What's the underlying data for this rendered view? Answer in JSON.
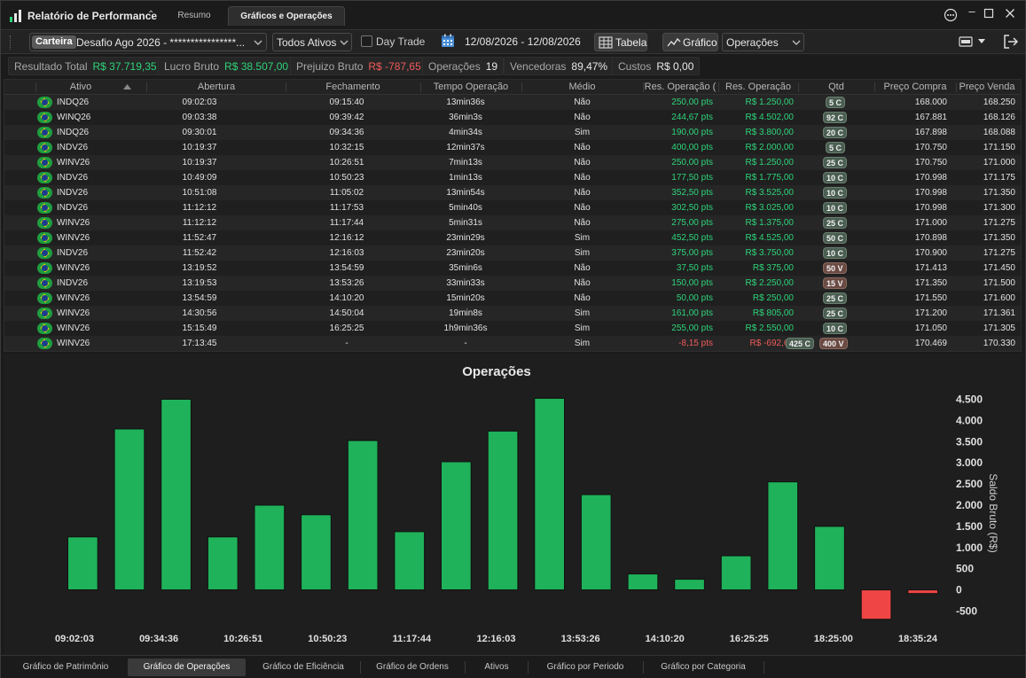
{
  "app": {
    "title": "Relatório de Performance",
    "tabs": [
      {
        "label": "Resumo"
      },
      {
        "label": "Gráficos e Operações"
      }
    ]
  },
  "toolbar": {
    "carteira_label": "Carteira",
    "carteira_name": "Desafio Ago 2026 - ****************...",
    "ativos_select": "Todos Ativos",
    "day_trade_label": "Day Trade",
    "date_range": "12/08/2026 - 12/08/2026",
    "tabela_label": "Tabela",
    "grafico_label": "Gráfico",
    "view_select": "Operações"
  },
  "summary": [
    {
      "key": "Resultado Total",
      "value": "R$ 37.719,35",
      "tone": "pos"
    },
    {
      "key": "Lucro Bruto",
      "value": "R$ 38.507,00",
      "tone": "pos"
    },
    {
      "key": "Prejuizo Bruto",
      "value": "R$ -787,65",
      "tone": "neg"
    },
    {
      "key": "Operações",
      "value": "19",
      "tone": ""
    },
    {
      "key": "Vencedoras",
      "value": "89,47%",
      "tone": ""
    },
    {
      "key": "Custos",
      "value": "R$ 0,00",
      "tone": ""
    }
  ],
  "table": {
    "headers": [
      "Ativo",
      "Abertura",
      "Fechamento",
      "Tempo Operação",
      "Médio",
      "Res. Operação (",
      "Res. Operação",
      "Qtd",
      "Preço Compra",
      "Preço Venda"
    ],
    "rows": [
      {
        "ativo": "INDQ26",
        "abertura": "09:02:03",
        "fechamento": "09:15:40",
        "tempo": "13min36s",
        "medio": "Não",
        "pts": "250,00 pts",
        "rs": "R$ 1.250,00",
        "tone": "pos",
        "qtd": [
          {
            "t": "5 C",
            "k": "c"
          }
        ],
        "compra": "168.000",
        "venda": "168.250"
      },
      {
        "ativo": "WINQ26",
        "abertura": "09:03:38",
        "fechamento": "09:39:42",
        "tempo": "36min3s",
        "medio": "Não",
        "pts": "244,67 pts",
        "rs": "R$ 4.502,00",
        "tone": "pos",
        "qtd": [
          {
            "t": "92 C",
            "k": "c"
          }
        ],
        "compra": "167.881",
        "venda": "168.126"
      },
      {
        "ativo": "INDQ26",
        "abertura": "09:30:01",
        "fechamento": "09:34:36",
        "tempo": "4min34s",
        "medio": "Sim",
        "pts": "190,00 pts",
        "rs": "R$ 3.800,00",
        "tone": "pos",
        "qtd": [
          {
            "t": "20 C",
            "k": "c"
          }
        ],
        "compra": "167.898",
        "venda": "168.088"
      },
      {
        "ativo": "INDV26",
        "abertura": "10:19:37",
        "fechamento": "10:32:15",
        "tempo": "12min37s",
        "medio": "Não",
        "pts": "400,00 pts",
        "rs": "R$ 2.000,00",
        "tone": "pos",
        "qtd": [
          {
            "t": "5 C",
            "k": "c"
          }
        ],
        "compra": "170.750",
        "venda": "171.150"
      },
      {
        "ativo": "WINV26",
        "abertura": "10:19:37",
        "fechamento": "10:26:51",
        "tempo": "7min13s",
        "medio": "Não",
        "pts": "250,00 pts",
        "rs": "R$ 1.250,00",
        "tone": "pos",
        "qtd": [
          {
            "t": "25 C",
            "k": "c"
          }
        ],
        "compra": "170.750",
        "venda": "171.000"
      },
      {
        "ativo": "INDV26",
        "abertura": "10:49:09",
        "fechamento": "10:50:23",
        "tempo": "1min13s",
        "medio": "Não",
        "pts": "177,50 pts",
        "rs": "R$ 1.775,00",
        "tone": "pos",
        "qtd": [
          {
            "t": "10 C",
            "k": "c"
          }
        ],
        "compra": "170.998",
        "venda": "171.175"
      },
      {
        "ativo": "INDV26",
        "abertura": "10:51:08",
        "fechamento": "11:05:02",
        "tempo": "13min54s",
        "medio": "Não",
        "pts": "352,50 pts",
        "rs": "R$ 3.525,00",
        "tone": "pos",
        "qtd": [
          {
            "t": "10 C",
            "k": "c"
          }
        ],
        "compra": "170.998",
        "venda": "171.350"
      },
      {
        "ativo": "INDV26",
        "abertura": "11:12:12",
        "fechamento": "11:17:53",
        "tempo": "5min40s",
        "medio": "Não",
        "pts": "302,50 pts",
        "rs": "R$ 3.025,00",
        "tone": "pos",
        "qtd": [
          {
            "t": "10 C",
            "k": "c"
          }
        ],
        "compra": "170.998",
        "venda": "171.300"
      },
      {
        "ativo": "WINV26",
        "abertura": "11:12:12",
        "fechamento": "11:17:44",
        "tempo": "5min31s",
        "medio": "Não",
        "pts": "275,00 pts",
        "rs": "R$ 1.375,00",
        "tone": "pos",
        "qtd": [
          {
            "t": "25 C",
            "k": "c"
          }
        ],
        "compra": "171.000",
        "venda": "171.275"
      },
      {
        "ativo": "WINV26",
        "abertura": "11:52:47",
        "fechamento": "12:16:12",
        "tempo": "23min29s",
        "medio": "Sim",
        "pts": "452,50 pts",
        "rs": "R$ 4.525,00",
        "tone": "pos",
        "qtd": [
          {
            "t": "50 C",
            "k": "c"
          }
        ],
        "compra": "170.898",
        "venda": "171.350"
      },
      {
        "ativo": "INDV26",
        "abertura": "11:52:42",
        "fechamento": "12:16:03",
        "tempo": "23min20s",
        "medio": "Sim",
        "pts": "375,00 pts",
        "rs": "R$ 3.750,00",
        "tone": "pos",
        "qtd": [
          {
            "t": "10 C",
            "k": "c"
          }
        ],
        "compra": "170.900",
        "venda": "171.275"
      },
      {
        "ativo": "WINV26",
        "abertura": "13:19:52",
        "fechamento": "13:54:59",
        "tempo": "35min6s",
        "medio": "Não",
        "pts": "37,50 pts",
        "rs": "R$ 375,00",
        "tone": "pos",
        "qtd": [
          {
            "t": "50 V",
            "k": "v"
          }
        ],
        "compra": "171.413",
        "venda": "171.450"
      },
      {
        "ativo": "INDV26",
        "abertura": "13:19:53",
        "fechamento": "13:53:26",
        "tempo": "33min33s",
        "medio": "Não",
        "pts": "150,00 pts",
        "rs": "R$ 2.250,00",
        "tone": "pos",
        "qtd": [
          {
            "t": "15 V",
            "k": "v"
          }
        ],
        "compra": "171.350",
        "venda": "171.500"
      },
      {
        "ativo": "WINV26",
        "abertura": "13:54:59",
        "fechamento": "14:10:20",
        "tempo": "15min20s",
        "medio": "Não",
        "pts": "50,00 pts",
        "rs": "R$ 250,00",
        "tone": "pos",
        "qtd": [
          {
            "t": "25 C",
            "k": "c"
          }
        ],
        "compra": "171.550",
        "venda": "171.600"
      },
      {
        "ativo": "WINV26",
        "abertura": "14:30:56",
        "fechamento": "14:50:04",
        "tempo": "19min8s",
        "medio": "Sim",
        "pts": "161,00 pts",
        "rs": "R$ 805,00",
        "tone": "pos",
        "qtd": [
          {
            "t": "25 C",
            "k": "c"
          }
        ],
        "compra": "171.200",
        "venda": "171.361"
      },
      {
        "ativo": "WINV26",
        "abertura": "15:15:49",
        "fechamento": "16:25:25",
        "tempo": "1h9min36s",
        "medio": "Sim",
        "pts": "255,00 pts",
        "rs": "R$ 2.550,00",
        "tone": "pos",
        "qtd": [
          {
            "t": "10 C",
            "k": "c"
          }
        ],
        "compra": "171.050",
        "venda": "171.305"
      },
      {
        "ativo": "WINV26",
        "abertura": "17:13:45",
        "fechamento": "-",
        "tempo": "-",
        "medio": "Sim",
        "pts": "-8,15 pts",
        "rs": "R$ -692,65",
        "tone": "neg",
        "qtd": [
          {
            "t": "425 C",
            "k": "c"
          },
          {
            "t": "400 V",
            "k": "v"
          }
        ],
        "compra": "170.469",
        "venda": "170.330"
      }
    ]
  },
  "chart_data": {
    "type": "bar",
    "title": "Operações",
    "ylabel": "Saldo Bruto (R$)",
    "ylim": [
      -700,
      4700
    ],
    "yticks": [
      4500,
      4000,
      3500,
      3000,
      2500,
      2000,
      1500,
      1000,
      500,
      0,
      -500
    ],
    "ytick_labels": [
      "4.500",
      "4.000",
      "3.500",
      "3.000",
      "2.500",
      "2.000",
      "1.500",
      "1.000",
      "500",
      "0",
      "-500"
    ],
    "xtick_labels": [
      "09:02:03",
      "09:34:36",
      "10:26:51",
      "10:50:23",
      "11:17:44",
      "12:16:03",
      "13:53:26",
      "14:10:20",
      "16:25:25",
      "18:25:00",
      "18:35:24"
    ],
    "values": [
      1250,
      3800,
      4502,
      1250,
      2000,
      1775,
      3525,
      1375,
      3025,
      3750,
      4525,
      2250,
      375,
      250,
      805,
      2550,
      1500,
      -692.65,
      -85
    ],
    "positive_color": "#1fb25a",
    "negative_color": "#f04545",
    "grid": false
  },
  "bottom_tabs": [
    {
      "label": "Gráfico de Patrimônio"
    },
    {
      "label": "Gráfico de Operações"
    },
    {
      "label": "Gráfico de Eficiência"
    },
    {
      "label": "Gráfico de Ordens"
    },
    {
      "label": "Ativos"
    },
    {
      "label": "Gráfico por Periodo"
    },
    {
      "label": "Gráfico por Categoria"
    }
  ],
  "colors": {
    "accent_positive": "#2ed47a",
    "accent_negative": "#f05a5a",
    "background": "#1e1e1e"
  }
}
